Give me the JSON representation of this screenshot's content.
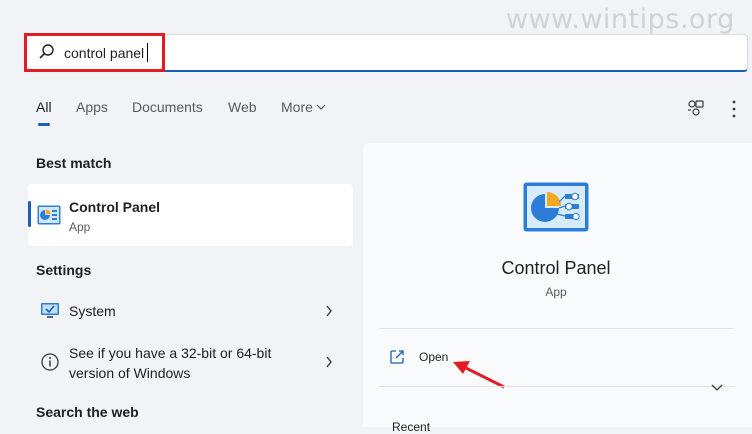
{
  "watermark": "www.wintips.org",
  "search": {
    "query": "control panel"
  },
  "tabs": [
    {
      "label": "All"
    },
    {
      "label": "Apps"
    },
    {
      "label": "Documents"
    },
    {
      "label": "Web"
    },
    {
      "label": "More"
    }
  ],
  "sections": {
    "best_match": "Best match",
    "settings": "Settings",
    "search_web": "Search the web"
  },
  "best_match": {
    "title": "Control Panel",
    "type": "App"
  },
  "settings_items": [
    {
      "label": "System",
      "icon": "monitor-check-icon"
    },
    {
      "label_line1": "See if you have a 32-bit or 64-bit",
      "label_line2": "version of Windows",
      "icon": "info-icon"
    }
  ],
  "details": {
    "title": "Control Panel",
    "type": "App",
    "open_label": "Open",
    "cutoff_label": "Recent"
  },
  "colors": {
    "accent": "#1a5fb4",
    "highlight_red": "#e31b23"
  }
}
